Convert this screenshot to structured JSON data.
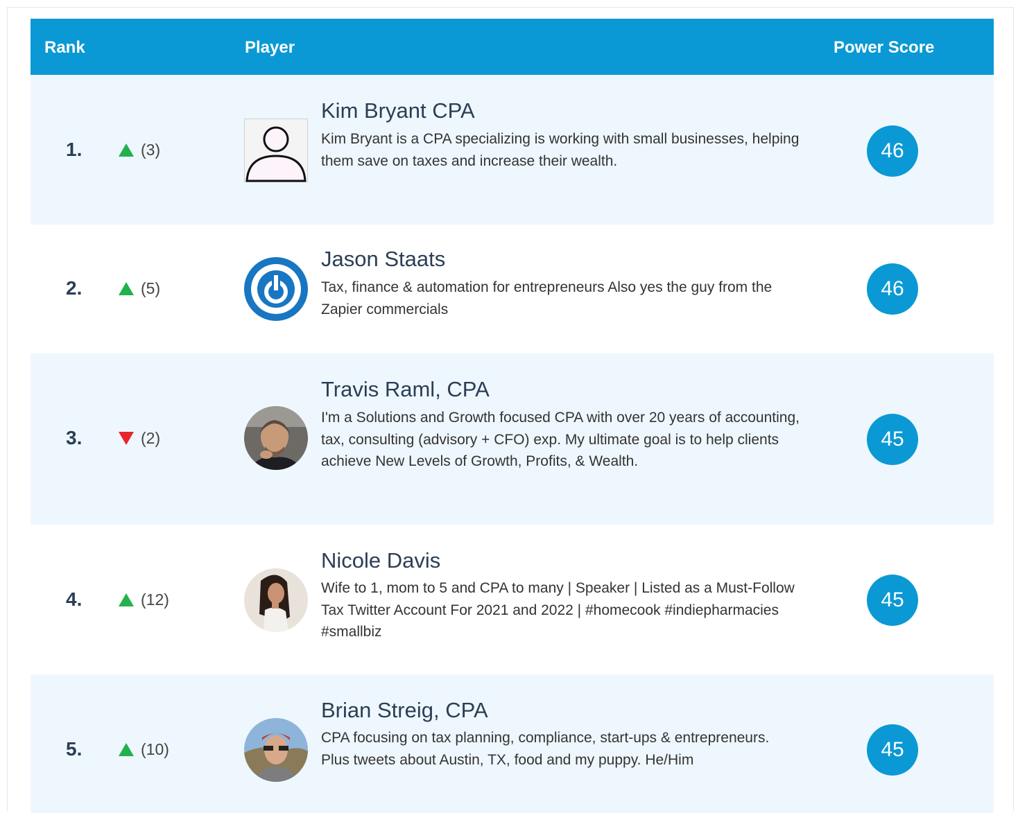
{
  "header": {
    "rank_label": "Rank",
    "player_label": "Player",
    "score_label": "Power Score"
  },
  "colors": {
    "accent": "#0a99d4",
    "row_shade": "#eef7fd",
    "up": "#22b14c",
    "down": "#e8262b"
  },
  "rows": [
    {
      "rank": "1.",
      "direction": "up",
      "change": "(3)",
      "avatar": "placeholder-person-icon",
      "name": "Kim Bryant CPA",
      "bio": "Kim Bryant is a CPA specializing is working with small businesses, helping them save on taxes and increase their wealth.",
      "score": "46"
    },
    {
      "rank": "2.",
      "direction": "up",
      "change": "(5)",
      "avatar": "blue-power-logo",
      "name": "Jason Staats",
      "bio": "Tax, finance & automation for entrepreneurs Also yes the guy from the Zapier commercials",
      "score": "46"
    },
    {
      "rank": "3.",
      "direction": "down",
      "change": "(2)",
      "avatar": "photo",
      "name": "Travis Raml, CPA",
      "bio": "I'm a Solutions and Growth focused CPA with over 20 years of accounting, tax, consulting (advisory + CFO) exp. My ultimate goal is to help clients achieve New Levels of Growth, Profits, & Wealth.",
      "score": "45"
    },
    {
      "rank": "4.",
      "direction": "up",
      "change": "(12)",
      "avatar": "photo",
      "name": "Nicole Davis",
      "bio": "Wife to 1, mom to 5 and CPA to many | Speaker | Listed as a Must-Follow Tax Twitter Account For 2021 and 2022 | #homecook #indiepharmacies #smallbiz",
      "score": "45"
    },
    {
      "rank": "5.",
      "direction": "up",
      "change": "(10)",
      "avatar": "photo",
      "name": "Brian Streig, CPA",
      "bio": "CPA focusing on tax planning, compliance, start-ups & entrepreneurs. Plus tweets about Austin, TX, food and my puppy. He/Him",
      "score": "45"
    }
  ]
}
